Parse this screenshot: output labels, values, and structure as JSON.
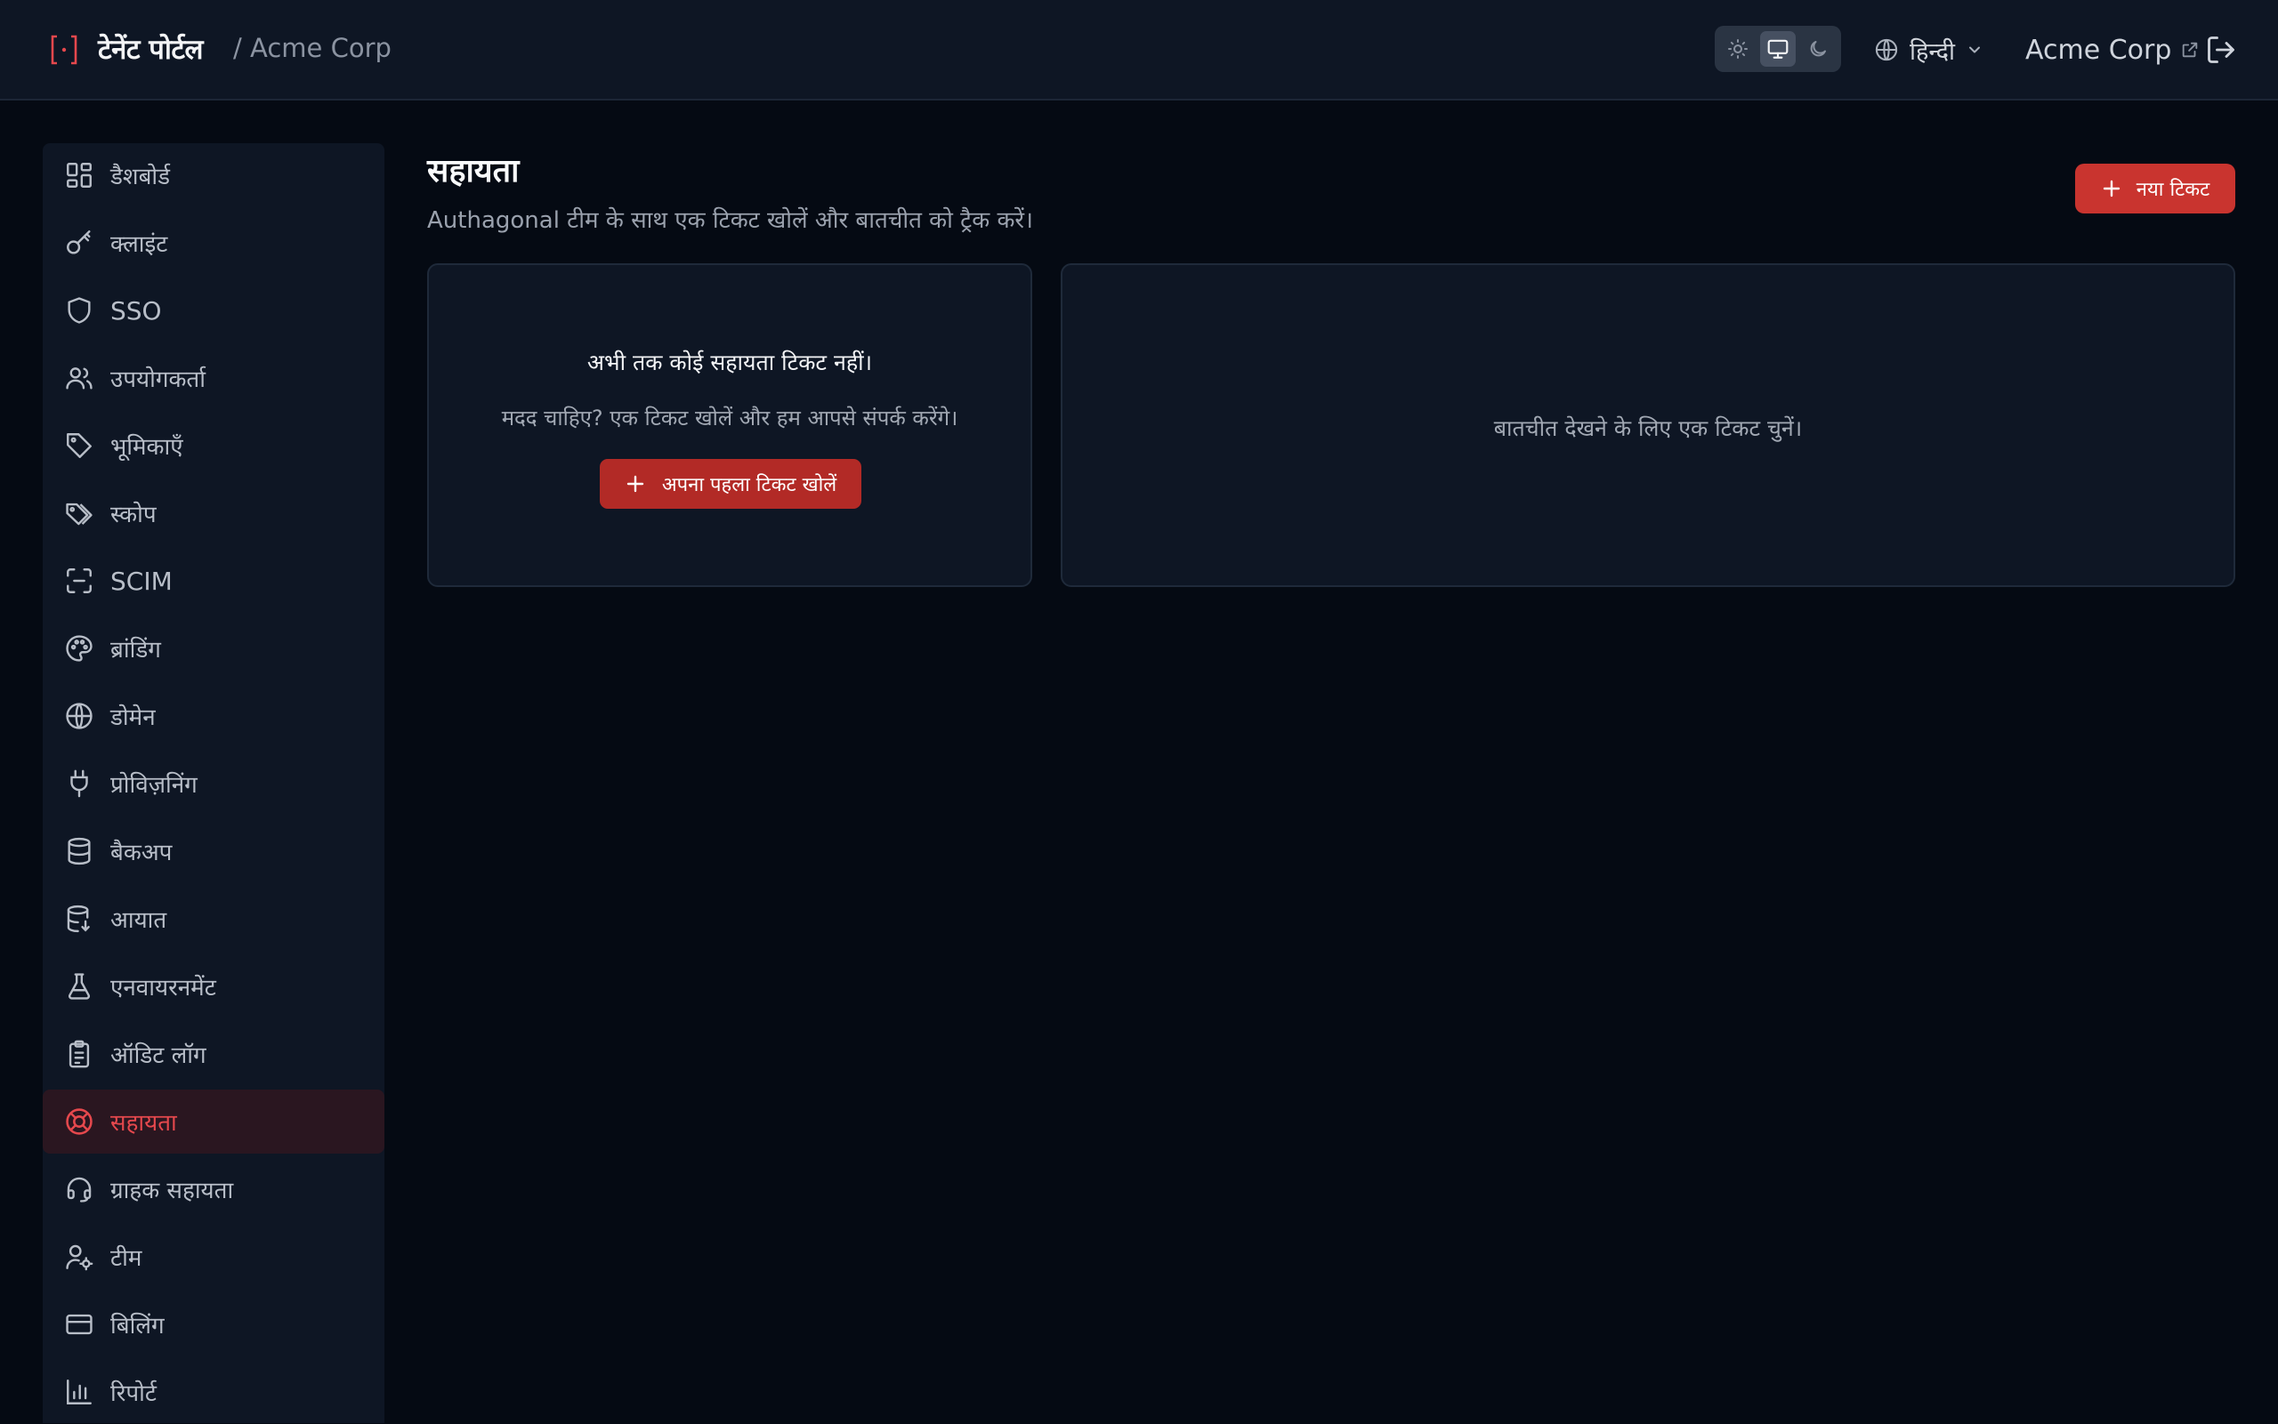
{
  "header": {
    "brand_title": "टेनेंट पोर्टल",
    "tenant_crumb": "/ Acme Corp",
    "language": "हिन्दी",
    "org_name": "Acme Corp",
    "theme_modes": [
      "light",
      "system",
      "dark"
    ],
    "active_theme": "system",
    "icons": {
      "brand": "bracket-dot-icon",
      "language": "globe-icon",
      "dropdown": "chevron-down-icon",
      "external": "external-link-icon",
      "logout": "log-out-icon"
    }
  },
  "sidebar": {
    "active": "सहायता",
    "items": [
      {
        "label": "डैशबोर्ड",
        "icon": "dashboard-icon"
      },
      {
        "label": "क्लाइंट",
        "icon": "key-icon"
      },
      {
        "label": "SSO",
        "icon": "shield-icon"
      },
      {
        "label": "उपयोगकर्ता",
        "icon": "users-icon"
      },
      {
        "label": "भूमिकाएँ",
        "icon": "tag-icon"
      },
      {
        "label": "स्कोप",
        "icon": "tags-icon"
      },
      {
        "label": "SCIM",
        "icon": "scan-icon"
      },
      {
        "label": "ब्रांडिंग",
        "icon": "palette-icon"
      },
      {
        "label": "डोमेन",
        "icon": "globe-icon"
      },
      {
        "label": "प्रोविज़निंग",
        "icon": "plug-icon"
      },
      {
        "label": "बैकअप",
        "icon": "database-icon"
      },
      {
        "label": "आयात",
        "icon": "database-import-icon"
      },
      {
        "label": "एनवायरनमेंट",
        "icon": "flask-icon"
      },
      {
        "label": "ऑडिट लॉग",
        "icon": "clipboard-icon"
      },
      {
        "label": "सहायता",
        "icon": "life-buoy-icon"
      },
      {
        "label": "ग्राहक सहायता",
        "icon": "headset-icon"
      },
      {
        "label": "टीम",
        "icon": "user-cog-icon"
      },
      {
        "label": "बिलिंग",
        "icon": "credit-card-icon"
      },
      {
        "label": "रिपोर्ट",
        "icon": "bar-chart-icon"
      }
    ]
  },
  "main": {
    "title": "सहायता",
    "subtitle": "Authagonal टीम के साथ एक टिकट खोलें और बातचीत को ट्रैक करें।",
    "new_ticket_label": "नया टिकट",
    "empty_state": {
      "title": "अभी तक कोई सहायता टिकट नहीं।",
      "text": "मदद चाहिए? एक टिकट खोलें और हम आपसे संपर्क करेंगे।",
      "button_label": "अपना पहला टिकट खोलें"
    },
    "conversation_placeholder": "बातचीत देखने के लिए एक टिकट चुनें।"
  },
  "colors": {
    "accent": "#c9342f",
    "active_nav_bg": "#2a1620",
    "active_nav_text": "#e5484d",
    "panel": "#0e1624",
    "page_bg": "#050a13"
  }
}
